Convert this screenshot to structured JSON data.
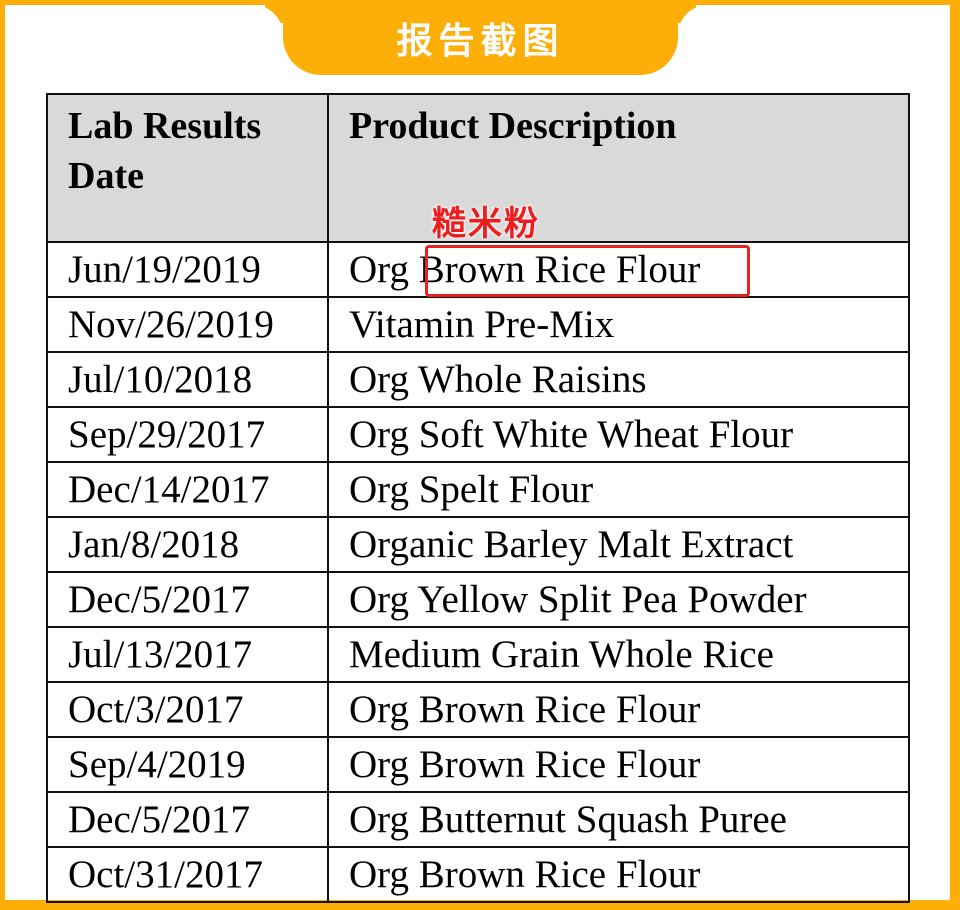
{
  "banner": {
    "title": "报告截图"
  },
  "table": {
    "headers": [
      "Lab Results Date",
      "Product Description"
    ],
    "rows": [
      {
        "date": "Jun/19/2019",
        "product_prefix": "Org ",
        "product_main": "Brown Rice Flour"
      },
      {
        "date": "Nov/26/2019",
        "product_prefix": "",
        "product_main": "Vitamin Pre-Mix"
      },
      {
        "date": "Jul/10/2018",
        "product_prefix": "",
        "product_main": "Org Whole Raisins"
      },
      {
        "date": "Sep/29/2017",
        "product_prefix": "",
        "product_main": "Org Soft White Wheat Flour"
      },
      {
        "date": "Dec/14/2017",
        "product_prefix": "",
        "product_main": "Org Spelt Flour"
      },
      {
        "date": "Jan/8/2018",
        "product_prefix": "",
        "product_main": "Organic Barley Malt Extract"
      },
      {
        "date": "Dec/5/2017",
        "product_prefix": "",
        "product_main": "Org Yellow Split Pea Powder"
      },
      {
        "date": "Jul/13/2017",
        "product_prefix": "",
        "product_main": "Medium Grain Whole Rice"
      },
      {
        "date": "Oct/3/2017",
        "product_prefix": "",
        "product_main": "Org Brown Rice Flour"
      },
      {
        "date": "Sep/4/2019",
        "product_prefix": "",
        "product_main": "Org Brown Rice Flour"
      },
      {
        "date": "Dec/5/2017",
        "product_prefix": "",
        "product_main": "Org Butternut Squash Puree"
      },
      {
        "date": "Oct/31/2017",
        "product_prefix": "",
        "product_main": "Org Brown Rice Flour"
      }
    ]
  },
  "annotation": {
    "label": "糙米粉",
    "highlighted_text": "Brown Rice Flour",
    "color": "#e8231f"
  },
  "colors": {
    "frame": "#FDAF08",
    "header_bg": "#d9d9d9"
  }
}
